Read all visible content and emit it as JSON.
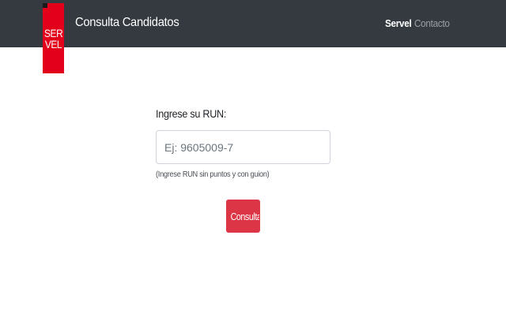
{
  "header": {
    "logo_top": "SER",
    "logo_bottom": "VEL",
    "brand_title": "Consulta Candidatos",
    "nav": {
      "servel": "Servel",
      "contacto": "Contacto"
    }
  },
  "form": {
    "label": "Ingrese su RUN:",
    "input_value": "",
    "input_placeholder": "Ej: 9605009-7",
    "help_text": "(Ingrese RUN sin puntos y con guion)",
    "submit_label": "Consultar"
  },
  "colors": {
    "navbar": "#343a40",
    "logo": "#e2001a",
    "button": "#dc3545"
  }
}
